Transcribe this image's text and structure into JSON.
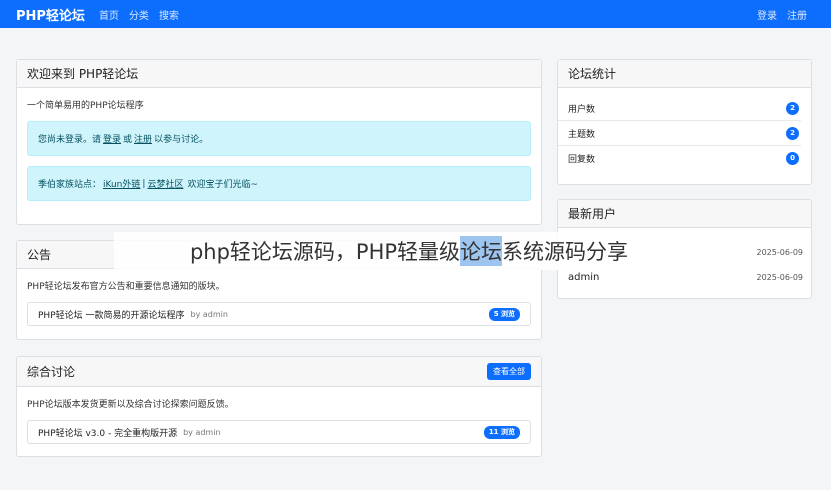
{
  "navbar": {
    "brand": "PHP轻论坛",
    "links": [
      "首页",
      "分类",
      "搜索"
    ],
    "right": [
      "登录",
      "注册"
    ]
  },
  "welcome": {
    "title": "欢迎来到 PHP轻论坛",
    "description": "一个简单易用的PHP论坛程序",
    "alert1": {
      "prefix": "您尚未登录。请",
      "login": "登录",
      "or": "或",
      "register": "注册",
      "suffix": "以参与讨论。"
    },
    "alert2": {
      "prefix": "季伯家族站点：",
      "link1": "iKun外链",
      "sep": "|",
      "link2": "云梦社区",
      "suffix": "欢迎宝子们光临~"
    }
  },
  "announcements": {
    "title": "公告",
    "description": "PHP轻论坛发布官方公告和重要信息通知的版块。",
    "topic": {
      "title": "PHP轻论坛 一款简易的开源论坛程序",
      "author": "by admin",
      "badge": "5 浏览"
    }
  },
  "general": {
    "title": "综合讨论",
    "view_all": "查看全部",
    "description": "PHP论坛版本发货更新以及综合讨论探索问题反馈。",
    "topic": {
      "title": "PHP轻论坛 v3.0 - 完全重构版开源",
      "author": "by admin",
      "badge": "11 浏览"
    }
  },
  "stats": {
    "title": "论坛统计",
    "rows": [
      {
        "label": "用户数",
        "value": "2"
      },
      {
        "label": "主题数",
        "value": "2"
      },
      {
        "label": "回复数",
        "value": "0"
      }
    ]
  },
  "new_users": {
    "title": "最新用户",
    "rows": [
      {
        "name": "",
        "date": "2025-06-09"
      },
      {
        "name": "admin",
        "date": "2025-06-09"
      }
    ]
  },
  "overlay": {
    "before": "php轻论坛源码，PHP轻量级",
    "highlight": "论坛",
    "after": "系统源码分享"
  },
  "colors": {
    "primary": "#0d6efd",
    "info_bg": "#cff4fc",
    "info_text": "#055160"
  }
}
